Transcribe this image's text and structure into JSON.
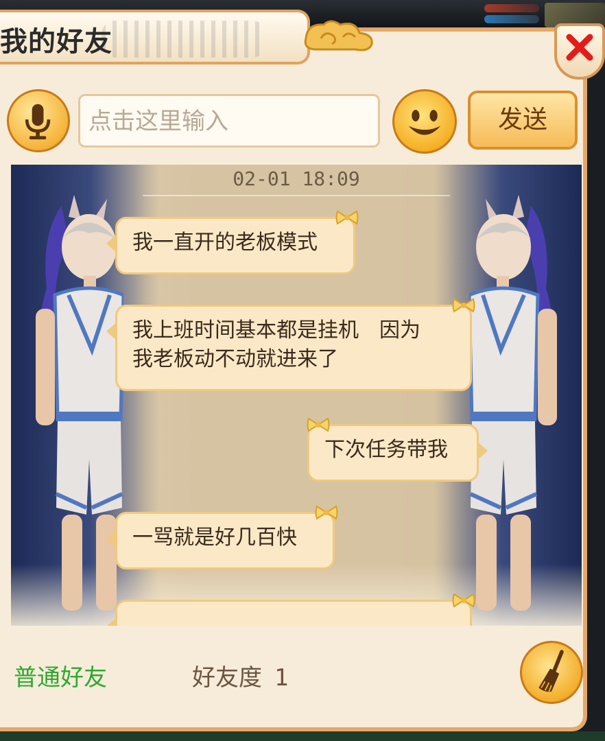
{
  "window": {
    "title": "我的好友",
    "close_icon": "close-icon"
  },
  "composer": {
    "placeholder": "点击这里输入",
    "value": "",
    "send_label": "发送",
    "mic_icon": "microphone-icon",
    "emoji_icon": "smiley-icon"
  },
  "chat": {
    "timestamp": "02-01 18:09",
    "messages": [
      {
        "side": "left",
        "text": "我一直开的老板模式"
      },
      {
        "side": "left",
        "lines": [
          "我上班时间基本都是挂机　因为",
          "我老板动不动就进来了"
        ]
      },
      {
        "side": "right",
        "text": "下次任务带我"
      },
      {
        "side": "left",
        "text": "一骂就是好几百快"
      },
      {
        "side": "left",
        "text": ""
      }
    ]
  },
  "footer": {
    "relation": "普通好友",
    "intimacy_label": "好友度",
    "intimacy_value": "1",
    "clear_icon": "broom-icon"
  },
  "colors": {
    "accent_orange": "#e6a769",
    "bubble_fill": "#fbe8c6",
    "relation_green": "#2fa82f",
    "close_red": "#e21b1b"
  }
}
